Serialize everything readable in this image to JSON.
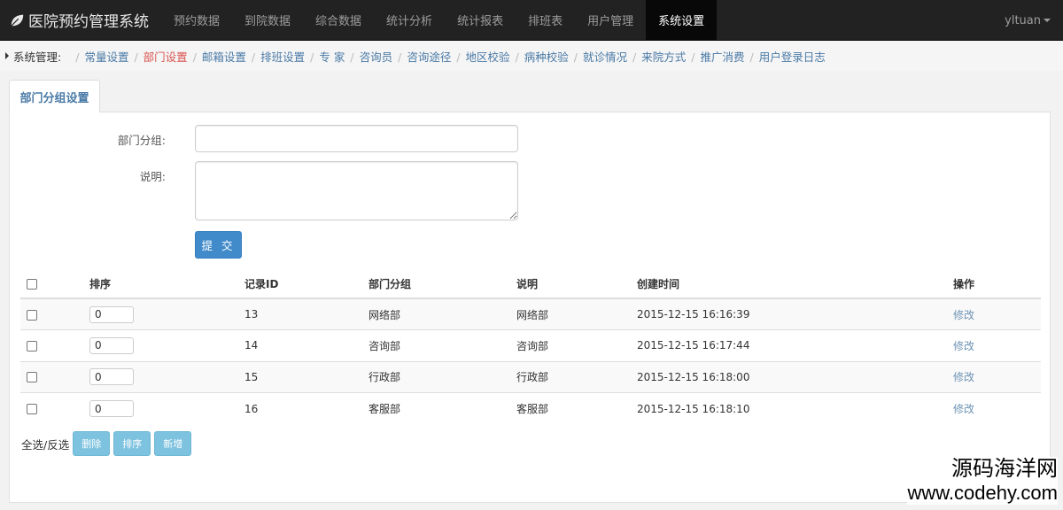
{
  "navbar": {
    "brand": "医院预约管理系统",
    "items": [
      "预约数据",
      "到院数据",
      "综合数据",
      "统计分析",
      "统计报表",
      "排班表",
      "用户管理",
      "系统设置"
    ],
    "active_index": 7,
    "user": "yltuan"
  },
  "breadcrumb": {
    "title": "系统管理:",
    "links": [
      "常量设置",
      "部门设置",
      "邮箱设置",
      "排班设置",
      "专 家",
      "咨询员",
      "咨询途径",
      "地区校验",
      "病种校验",
      "就诊情况",
      "来院方式",
      "推广消费",
      "用户登录日志"
    ],
    "current_index": 1
  },
  "tab": {
    "label": "部门分组设置"
  },
  "form": {
    "group_label": "部门分组:",
    "group_value": "",
    "desc_label": "说明:",
    "desc_value": "",
    "submit_label": "提 交"
  },
  "table": {
    "headers": [
      "排序",
      "记录ID",
      "部门分组",
      "说明",
      "创建时间",
      "操作"
    ],
    "rows": [
      {
        "sort": "0",
        "id": "13",
        "group": "网络部",
        "desc": "网络部",
        "created": "2015-12-15 16:16:39",
        "action": "修改"
      },
      {
        "sort": "0",
        "id": "14",
        "group": "咨询部",
        "desc": "咨询部",
        "created": "2015-12-15 16:17:44",
        "action": "修改"
      },
      {
        "sort": "0",
        "id": "15",
        "group": "行政部",
        "desc": "行政部",
        "created": "2015-12-15 16:18:00",
        "action": "修改"
      },
      {
        "sort": "0",
        "id": "16",
        "group": "客服部",
        "desc": "客服部",
        "created": "2015-12-15 16:18:10",
        "action": "修改"
      }
    ]
  },
  "footer": {
    "select_all": "全选/反选",
    "buttons": [
      "删除",
      "排序",
      "新增"
    ]
  },
  "watermark": {
    "cn": "源码海洋网",
    "url": "www.codehy.com"
  }
}
